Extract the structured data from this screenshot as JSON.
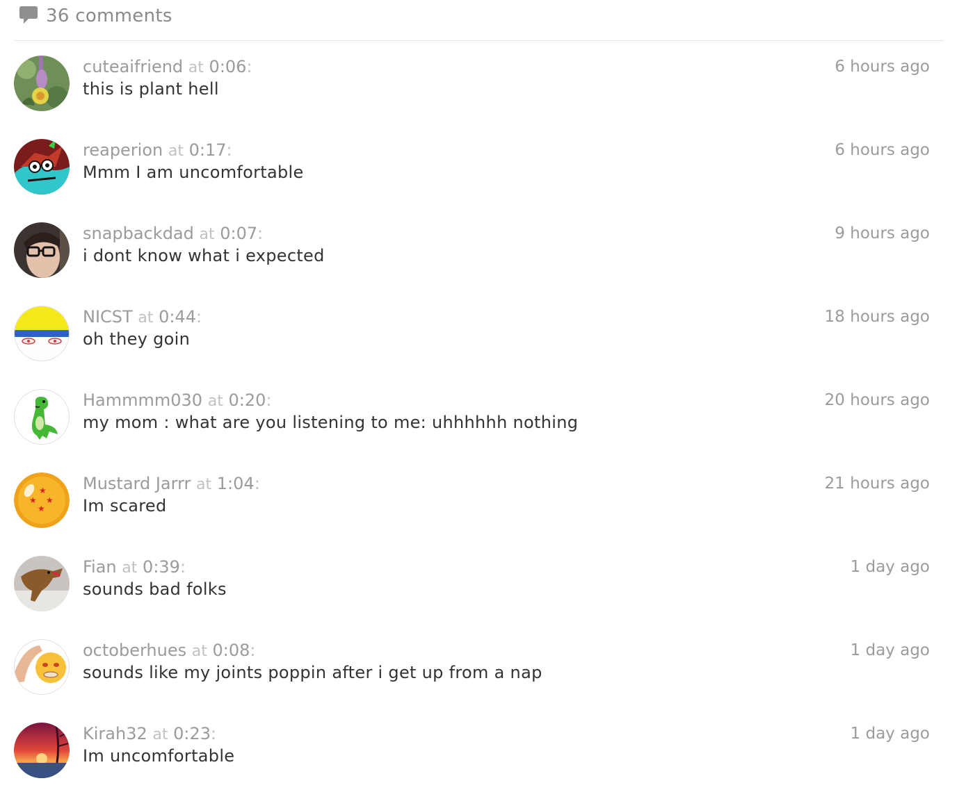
{
  "header": {
    "count_label": "36 comments",
    "icon": "speech-bubble-icon"
  },
  "comments": [
    {
      "user": "cuteaifriend",
      "at": "at",
      "time": "0:06",
      "text": "this is plant hell",
      "ago": "6 hours ago",
      "avatar": "plant-flower-avatar"
    },
    {
      "user": "reaperion",
      "at": "at",
      "time": "0:17",
      "text": "Mmm I am uncomfortable",
      "ago": "6 hours ago",
      "avatar": "dragon-drawing-avatar"
    },
    {
      "user": "snapbackdad",
      "at": "at",
      "time": "0:07",
      "text": "i dont know what i expected",
      "ago": "9 hours ago",
      "avatar": "person-glasses-avatar"
    },
    {
      "user": "NICST",
      "at": "at",
      "time": "0:44",
      "text": "oh they goin",
      "ago": "18 hours ago",
      "avatar": "cartoon-face-avatar"
    },
    {
      "user": "Hammmm030",
      "at": "at",
      "time": "0:20",
      "text": "my mom : what are you listening to me: uhhhhhh nothing",
      "ago": "20 hours ago",
      "avatar": "green-dinosaur-avatar"
    },
    {
      "user": "Mustard Jarrr",
      "at": "at",
      "time": "1:04",
      "text": "Im scared",
      "ago": "21 hours ago",
      "avatar": "dragon-ball-avatar"
    },
    {
      "user": "Fian",
      "at": "at",
      "time": "0:39",
      "text": "sounds bad folks",
      "ago": "1 day ago",
      "avatar": "dinosaur-toy-avatar"
    },
    {
      "user": "octoberhues",
      "at": "at",
      "time": "0:08",
      "text": "sounds like my joints poppin after i get up from a nap",
      "ago": "1 day ago",
      "avatar": "emoji-face-hand-avatar"
    },
    {
      "user": "Kirah32",
      "at": "at",
      "time": "0:23",
      "text": "Im uncomfortable",
      "ago": "1 day ago",
      "avatar": "sunset-landscape-avatar"
    }
  ],
  "colors": {
    "muted": "#9b9b9b",
    "light": "#c1c1c1",
    "text": "#333333",
    "divider": "#e6e6e6"
  }
}
